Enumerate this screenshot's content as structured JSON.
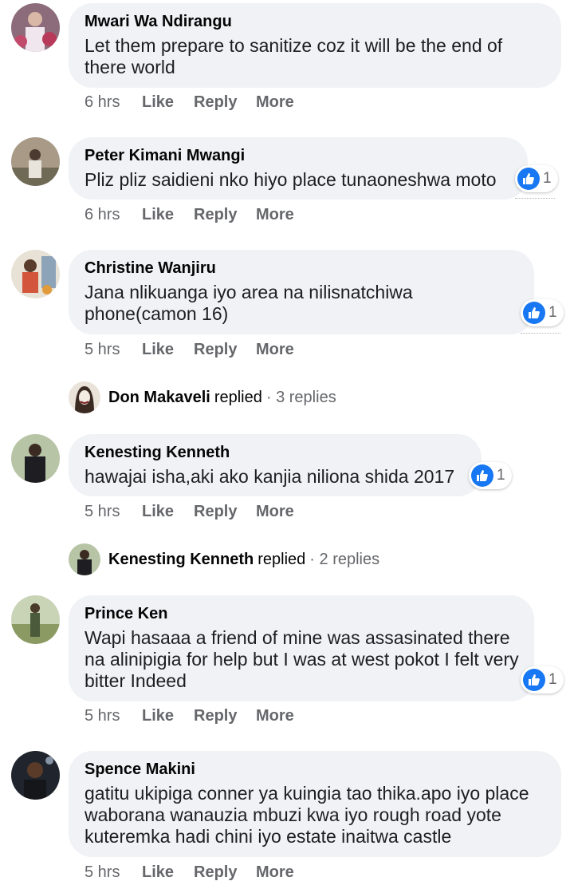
{
  "actions": {
    "like": "Like",
    "reply": "Reply",
    "more": "More"
  },
  "comments": [
    {
      "author": "Mwari Wa Ndirangu",
      "text": "Let them prepare to sanitize coz it will be the end of there world",
      "time": "6 hrs"
    },
    {
      "author": "Peter Kimani Mwangi",
      "text": "Pliz pliz saidieni nko hiyo place tunaoneshwa moto",
      "time": "6 hrs",
      "reactions": "1"
    },
    {
      "author": "Christine Wanjiru",
      "text": "Jana nlikuanga iyo area na nilisnatchiwa phone(camon 16)",
      "time": "5 hrs",
      "reactions": "1"
    },
    {
      "author": "Kenesting Kenneth",
      "text": "hawajai isha,aki ako kanjia niliona shida 2017",
      "time": "5 hrs",
      "reactions": "1"
    },
    {
      "author": "Prince Ken",
      "text": "Wapi hasaaa a friend of mine was assasinated there na alinipigia for help but I was at west pokot I felt very bitter Indeed",
      "time": "5 hrs",
      "reactions": "1"
    },
    {
      "author": "Spence Makini",
      "text": "gatitu ukipiga conner ya kuingia tao thika.apo iyo place waborana wanauzia mbuzi kwa iyo rough road yote kuteremka hadi chini iyo estate inaitwa castle",
      "time": "5 hrs"
    }
  ],
  "replies": [
    {
      "name": "Don Makaveli",
      "word": "replied",
      "count": "· 3 replies"
    },
    {
      "name": "Kenesting Kenneth",
      "word": "replied",
      "count": "· 2 replies"
    }
  ],
  "colors": {
    "like_blue": "#1877f2",
    "bubble": "#f0f2f5",
    "meta": "#65676b"
  }
}
